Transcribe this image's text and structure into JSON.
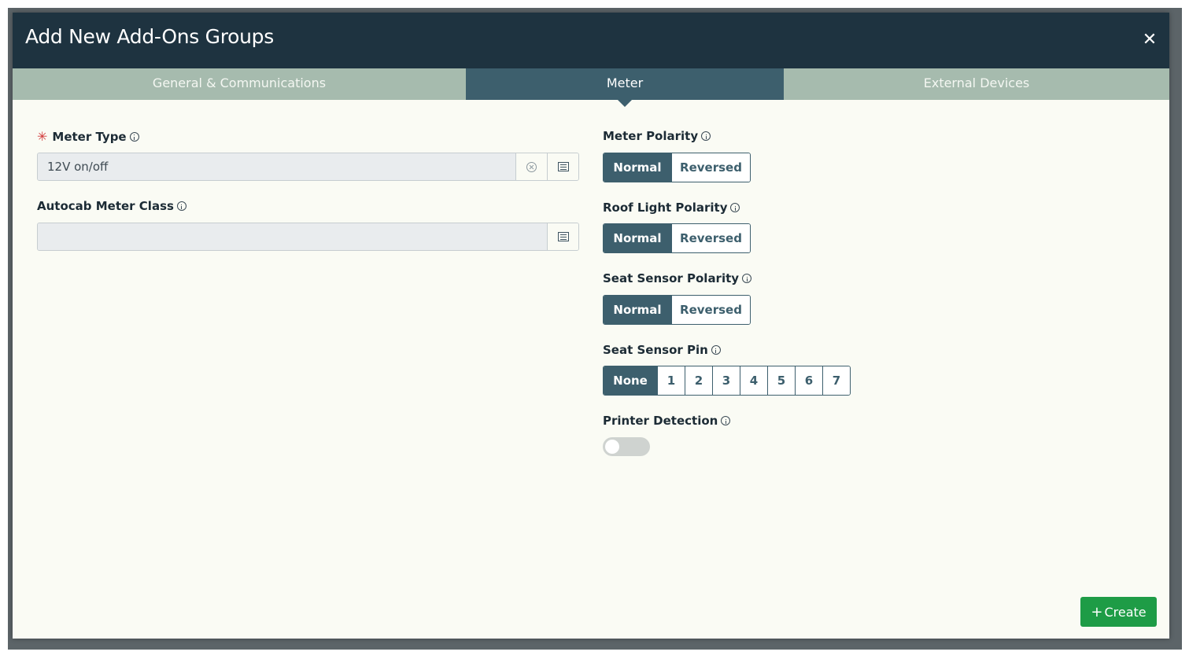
{
  "modal": {
    "title": "Add New Add-Ons Groups",
    "close_symbol": "✕"
  },
  "tabs": [
    {
      "label": "General & Communications",
      "active": false
    },
    {
      "label": "Meter",
      "active": true
    },
    {
      "label": "External Devices",
      "active": false
    }
  ],
  "left": {
    "meter_type": {
      "label": "Meter Type",
      "required": true,
      "value": "12V on/off",
      "icons": [
        "info-icon",
        "clear-icon",
        "list-icon"
      ]
    },
    "autocab_meter_class": {
      "label": "Autocab Meter Class",
      "value": "",
      "icons": [
        "info-icon",
        "list-icon"
      ]
    }
  },
  "right": {
    "meter_polarity": {
      "label": "Meter Polarity",
      "options": [
        "Normal",
        "Reversed"
      ],
      "selected": "Normal"
    },
    "roof_light_polarity": {
      "label": "Roof Light Polarity",
      "options": [
        "Normal",
        "Reversed"
      ],
      "selected": "Normal"
    },
    "seat_sensor_polarity": {
      "label": "Seat Sensor Polarity",
      "options": [
        "Normal",
        "Reversed"
      ],
      "selected": "Normal"
    },
    "seat_sensor_pin": {
      "label": "Seat Sensor Pin",
      "options": [
        "None",
        "1",
        "2",
        "3",
        "4",
        "5",
        "6",
        "7"
      ],
      "selected": "None"
    },
    "printer_detection": {
      "label": "Printer Detection",
      "enabled": false
    }
  },
  "footer": {
    "create_label": "Create",
    "create_icon": "plus-icon"
  },
  "colors": {
    "header_bg": "#1e3340",
    "tab_inactive": "#a6bbae",
    "tab_active": "#3d5f6d",
    "primary": "#3d5f6d",
    "create_green": "#1e9c46",
    "required": "#d23a3a"
  }
}
